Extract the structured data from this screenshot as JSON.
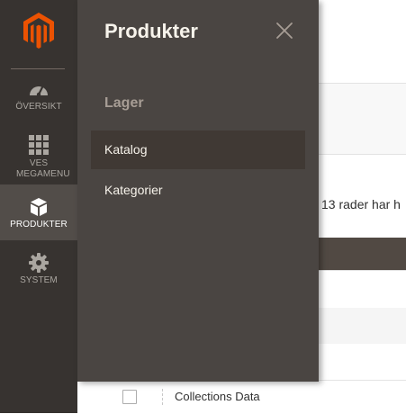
{
  "sidebar": {
    "items": [
      {
        "label": "ÖVERSIKT",
        "icon": "speedometer-icon"
      },
      {
        "label": "VES MEGAMENU",
        "icon": "grid-icon"
      },
      {
        "label": "PRODUKTER",
        "icon": "box-icon"
      },
      {
        "label": "SYSTEM",
        "icon": "gear-icon"
      }
    ]
  },
  "flyout": {
    "title": "Produkter",
    "section": "Lager",
    "items": [
      {
        "label": "Katalog"
      },
      {
        "label": "Kategorier"
      }
    ]
  },
  "background": {
    "records_text": "13 rader har h",
    "row_label": "Collections Data"
  },
  "colors": {
    "sidebar_bg": "#373330",
    "flyout_bg": "#4a4542",
    "brand_orange": "#eb5202"
  }
}
